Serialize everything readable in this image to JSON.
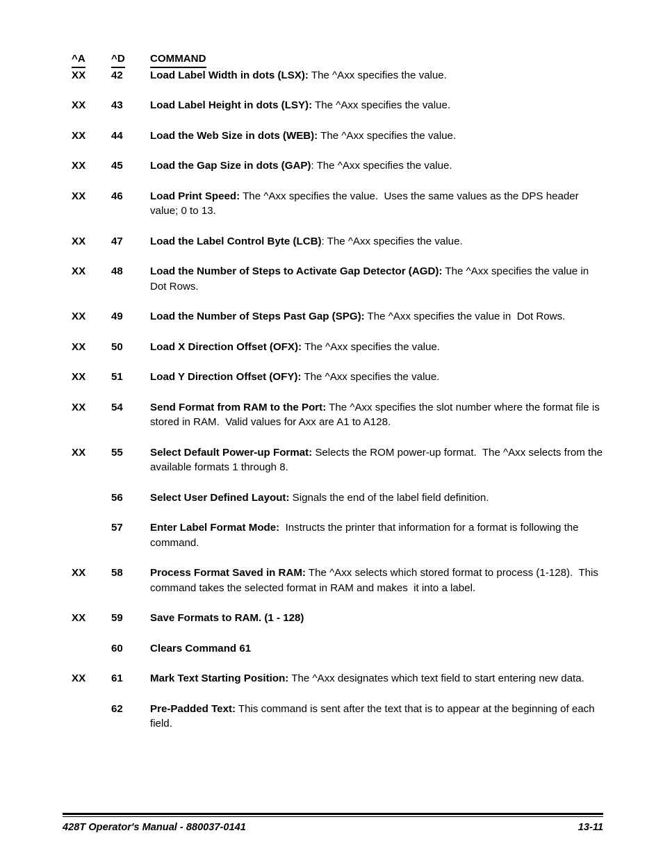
{
  "document": {
    "title": "428T Operator's Manual - 880037-0141",
    "page_number": "13-11"
  },
  "table": {
    "headers": {
      "col_a": "^A",
      "col_d": "^D",
      "col_command": "COMMAND"
    },
    "rows": [
      {
        "a": "XX",
        "d": "42",
        "name": "Load Label Width in dots (LSX):",
        "desc": " The ^Axx specifies the value."
      },
      {
        "a": "XX",
        "d": "43",
        "name": "Load Label Height in dots (LSY):",
        "desc": " The ^Axx specifies the value."
      },
      {
        "a": "XX",
        "d": "44",
        "name": "Load the Web Size in dots (WEB):",
        "desc": " The ^Axx specifies the value."
      },
      {
        "a": "XX",
        "d": "45",
        "name": "Load the Gap Size in dots (GAP)",
        "desc": ": The ^Axx specifies the value."
      },
      {
        "a": "XX",
        "d": "46",
        "name": "Load Print Speed:",
        "desc": " The ^Axx specifies the value.  Uses the same values as the DPS header value; 0 to 13."
      },
      {
        "a": "XX",
        "d": "47",
        "name": "Load the Label Control Byte (LCB)",
        "desc": ": The ^Axx specifies the value."
      },
      {
        "a": "XX",
        "d": "48",
        "name": "Load the Number of Steps to Activate Gap Detector (AGD):",
        "desc": " The ^Axx specifies the value in Dot Rows."
      },
      {
        "a": "XX",
        "d": "49",
        "name": "Load the Number of Steps Past Gap (SPG):",
        "desc": " The ^Axx specifies the value in  Dot Rows."
      },
      {
        "a": "XX",
        "d": "50",
        "name": "Load X Direction Offset (OFX):",
        "desc": " The ^Axx specifies the value."
      },
      {
        "a": "XX",
        "d": "51",
        "name": "Load Y Direction Offset (OFY):",
        "desc": " The ^Axx specifies the value."
      },
      {
        "a": "XX",
        "d": "54",
        "name": "Send Format from RAM to the Port:",
        "desc": " The ^Axx specifies the slot number where the format file is stored in RAM.  Valid values for Axx are A1 to A128."
      },
      {
        "a": "XX",
        "d": "55",
        "name": "Select Default Power-up Format:",
        "desc": " Selects the ROM power-up format.  The ^Axx selects from the available formats 1 through 8."
      },
      {
        "a": "",
        "d": "56",
        "name": "Select User Defined Layout:",
        "desc": " Signals the end of the label field definition."
      },
      {
        "a": "",
        "d": "57",
        "name": "Enter Label Format Mode:",
        "desc": "  Instructs the printer that information for a format is following the command."
      },
      {
        "a": "XX",
        "d": "58",
        "name": "Process Format Saved in RAM:",
        "desc": " The ^Axx selects which stored format to process (1-128).  This command takes the selected format in RAM and makes  it into a label."
      },
      {
        "a": "XX",
        "d": "59",
        "name": "Save Formats to RAM. (1 - 128)",
        "desc": ""
      },
      {
        "a": "",
        "d": "60",
        "name": "Clears Command 61",
        "desc": ""
      },
      {
        "a": "XX",
        "d": "61",
        "name": "Mark Text Starting Position:",
        "desc": " The ^Axx designates which text field to start entering new data."
      },
      {
        "a": "",
        "d": "62",
        "name": "Pre-Padded Text:",
        "desc": " This command is sent after the text that is to appear at the beginning of each field."
      }
    ]
  }
}
